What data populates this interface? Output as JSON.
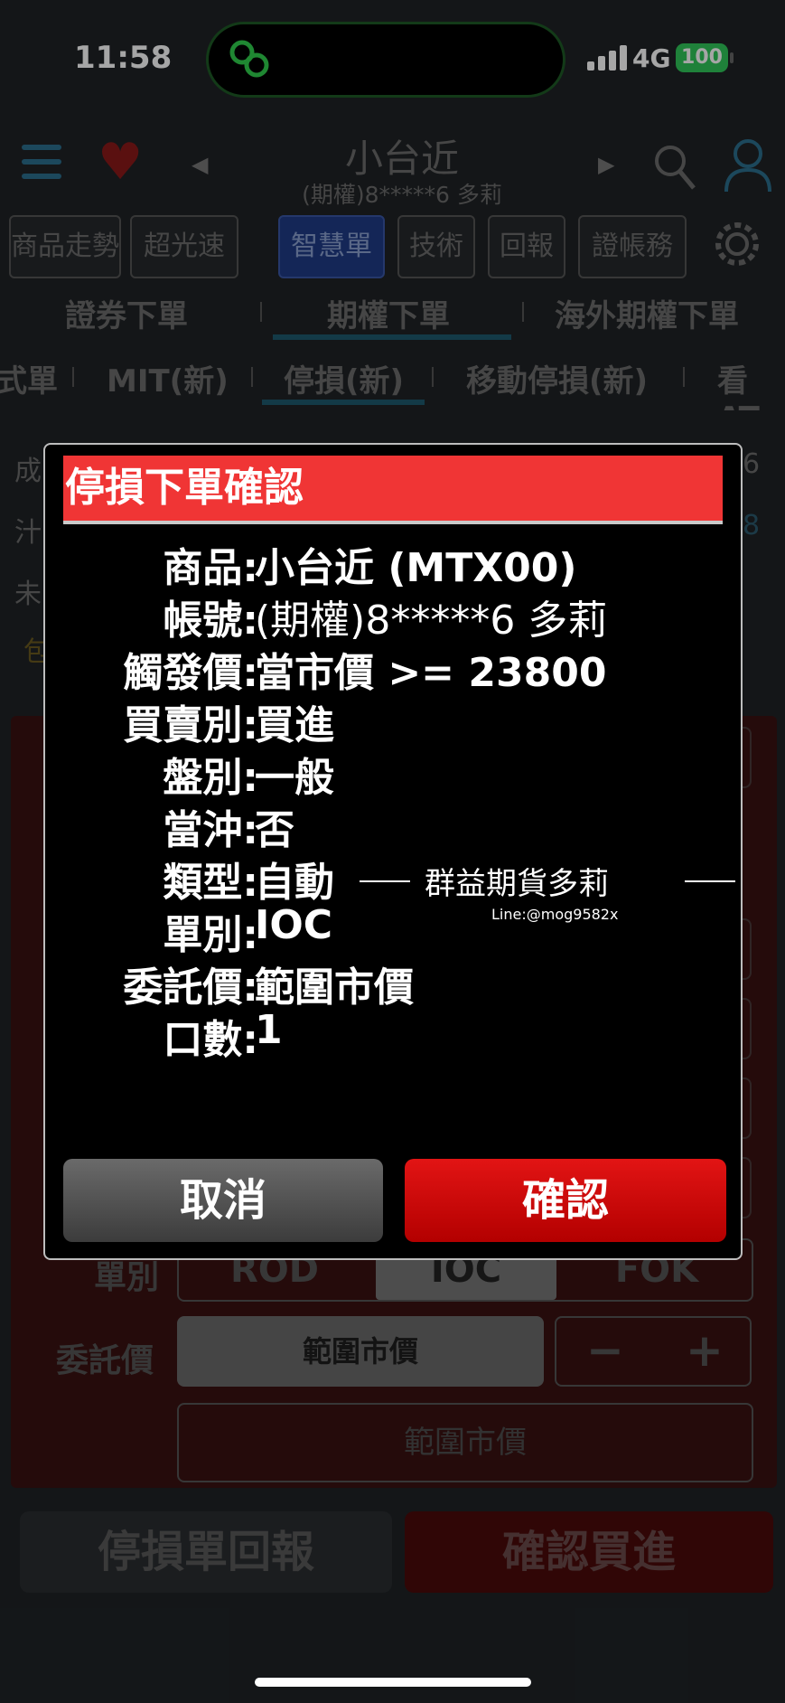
{
  "status_bar": {
    "time": "11:58",
    "network": "4G",
    "battery": "100"
  },
  "header": {
    "title": "小台近",
    "subtitle": "(期權)8*****6 多莉"
  },
  "toolbar": {
    "items": [
      "商品走勢",
      "超光速",
      "智慧單",
      "技術",
      "回報",
      "證帳務"
    ]
  },
  "tabs": {
    "items": [
      "證券下單",
      "期權下單",
      "海外期權下單"
    ],
    "active": "期權下單"
  },
  "subtabs": {
    "items": [
      "式單",
      "MIT(新)",
      "停損(新)",
      "移動停損(新)",
      "看AT"
    ],
    "active": "停損(新)"
  },
  "background_form": {
    "order_type_label": "單別",
    "order_types": [
      "ROD",
      "IOC",
      "FOK"
    ],
    "price_label": "委託價",
    "price_value": "範圍市價",
    "range_text": "範圍市價",
    "strip": [
      "成",
      "汁",
      "未",
      "包",
      "6",
      "8"
    ]
  },
  "bottom": {
    "left_button": "停損單回報",
    "right_button": "確認買進"
  },
  "dialog": {
    "title": "停損下單確認",
    "rows": [
      {
        "label": "商品:",
        "value": "小台近 (MTX00)"
      },
      {
        "label": "帳號:",
        "value": "(期權)8*****6  多莉"
      },
      {
        "label": "觸發價:",
        "value": "當市價 >= 23800"
      },
      {
        "label": "買賣別:",
        "value": "買進"
      },
      {
        "label": "盤別:",
        "value": "一般"
      },
      {
        "label": "當沖:",
        "value": "否"
      },
      {
        "label": "類型:",
        "value": "自動"
      },
      {
        "label": "單別:",
        "value": "IOC"
      },
      {
        "label": "委託價:",
        "value": "範圍市價"
      },
      {
        "label": "口數:",
        "value": "1"
      }
    ],
    "watermark": "群益期貨多莉",
    "watermark_sub": "Line:@mog9582x",
    "cancel_label": "取消",
    "confirm_label": "確認"
  },
  "colors": {
    "accent_red": "#f03535",
    "confirm_red": "#c90000",
    "active_tab_blue": "#1f3b86"
  }
}
